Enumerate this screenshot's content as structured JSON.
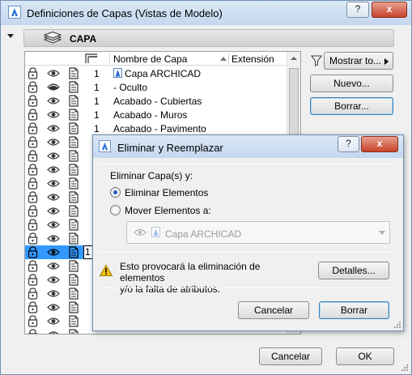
{
  "window": {
    "title": "Definiciones de Capas (Vistas de Modelo)",
    "help_label": "?",
    "close_label": "x"
  },
  "section": {
    "label": "CAPA"
  },
  "list": {
    "headers": {
      "name": "Nombre de Capa",
      "extension": "Extensión"
    },
    "rows": [
      {
        "num": "1",
        "name": "Capa ARCHICAD",
        "eye": "open",
        "icon": "archicad-layer-icon"
      },
      {
        "num": "1",
        "name": "- Oculto",
        "eye": "hidden"
      },
      {
        "num": "1",
        "name": "Acabado - Cubiertas",
        "eye": "open"
      },
      {
        "num": "1",
        "name": "Acabado - Muros",
        "eye": "open"
      },
      {
        "num": "1",
        "name": "Acabado - Pavimento",
        "eye": "open"
      },
      {
        "num": "",
        "name": "",
        "eye": "open"
      },
      {
        "num": "",
        "name": "",
        "eye": "open"
      },
      {
        "num": "",
        "name": "",
        "eye": "open"
      },
      {
        "num": "",
        "name": "",
        "eye": "open"
      },
      {
        "num": "",
        "name": "",
        "eye": "open"
      },
      {
        "num": "",
        "name": "",
        "eye": "open"
      },
      {
        "num": "",
        "name": "",
        "eye": "open"
      },
      {
        "num": "",
        "name": "",
        "eye": "open"
      },
      {
        "num": "1",
        "name": "",
        "eye": "open",
        "selected": true
      },
      {
        "num": "",
        "name": "",
        "eye": "open"
      },
      {
        "num": "",
        "name": "",
        "eye": "open"
      },
      {
        "num": "",
        "name": "",
        "eye": "open"
      },
      {
        "num": "",
        "name": "",
        "eye": "open"
      },
      {
        "num": "",
        "name": "",
        "eye": "open"
      },
      {
        "num": "",
        "name": "",
        "eye": "open"
      }
    ]
  },
  "side": {
    "show_button": "Mostrar to...",
    "new_button": "Nuevo...",
    "delete_button": "Borrar..."
  },
  "dialog": {
    "title": "Eliminar y Reemplazar",
    "help_label": "?",
    "close_label": "x",
    "prompt": "Eliminar Capa(s) y:",
    "option_delete": "Eliminar Elementos",
    "option_move": "Mover Elementos a:",
    "selected_option": "option_delete",
    "target_layer": "Capa ARCHICAD",
    "warning_line1": "Esto provocará la eliminación de elementos",
    "warning_line2": "y/o la falta de atributos.",
    "details_button": "Detalles...",
    "cancel_button": "Cancelar",
    "delete_button": "Borrar"
  },
  "footer": {
    "cancel_button": "Cancelar",
    "ok_button": "OK"
  },
  "colors": {
    "selection": "#3399ff",
    "title_gradient_top": "#dbe8f6",
    "title_gradient_bottom": "#c4d7ee",
    "close_button": "#c7432a"
  }
}
